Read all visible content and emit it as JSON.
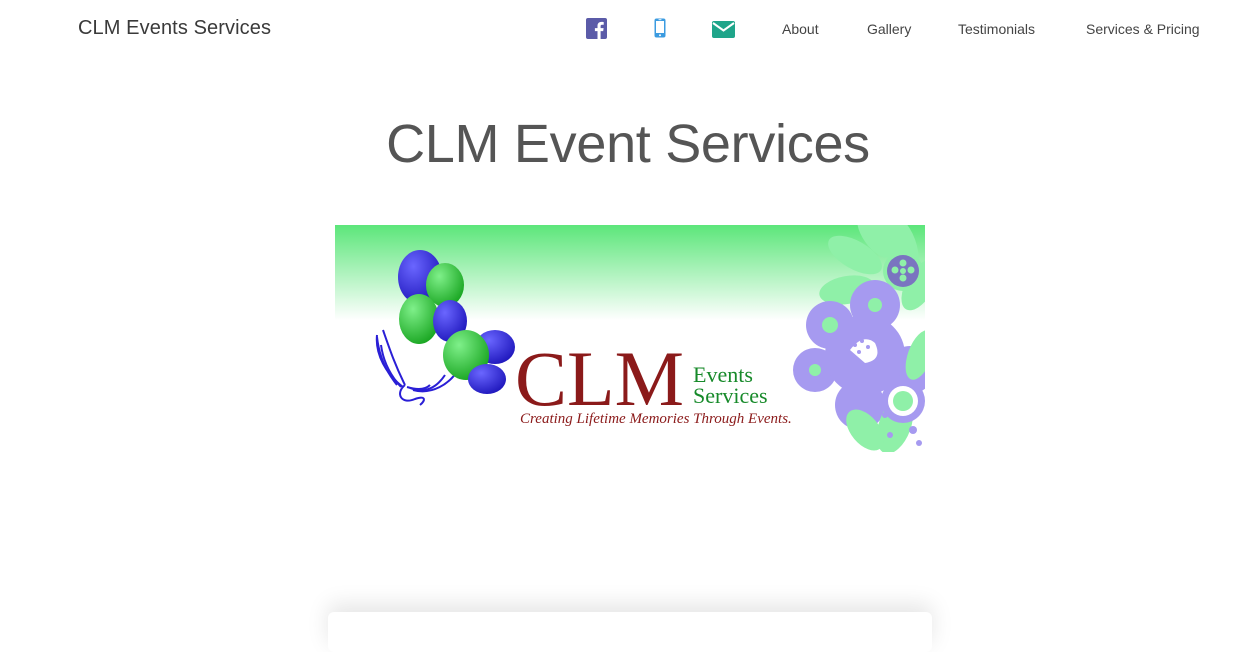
{
  "nav": {
    "brand": "CLM Events Services",
    "icons": [
      {
        "name": "facebook-icon",
        "color": "#5b5ba8"
      },
      {
        "name": "mobile-phone-icon",
        "color": "#3b9be0"
      },
      {
        "name": "envelope-icon",
        "color": "#1fa58a"
      }
    ],
    "links": [
      "About",
      "Gallery",
      "Testimonials",
      "Services & Pricing"
    ]
  },
  "main": {
    "title": "CLM Event Services",
    "banner": {
      "logo_main": "CLM",
      "logo_sub_1": "Events",
      "logo_sub_2": "Services",
      "tagline": "Creating Lifetime Memories Through Events."
    }
  },
  "colors": {
    "logo_red": "#8b1a1a",
    "logo_green": "#178a2a",
    "balloon_blue": "#2a1fd6",
    "balloon_green": "#26c02e",
    "flower_green": "#8ff0a8",
    "flower_purple": "#a69af0",
    "banner_gradient_top": "#5ce67a"
  }
}
